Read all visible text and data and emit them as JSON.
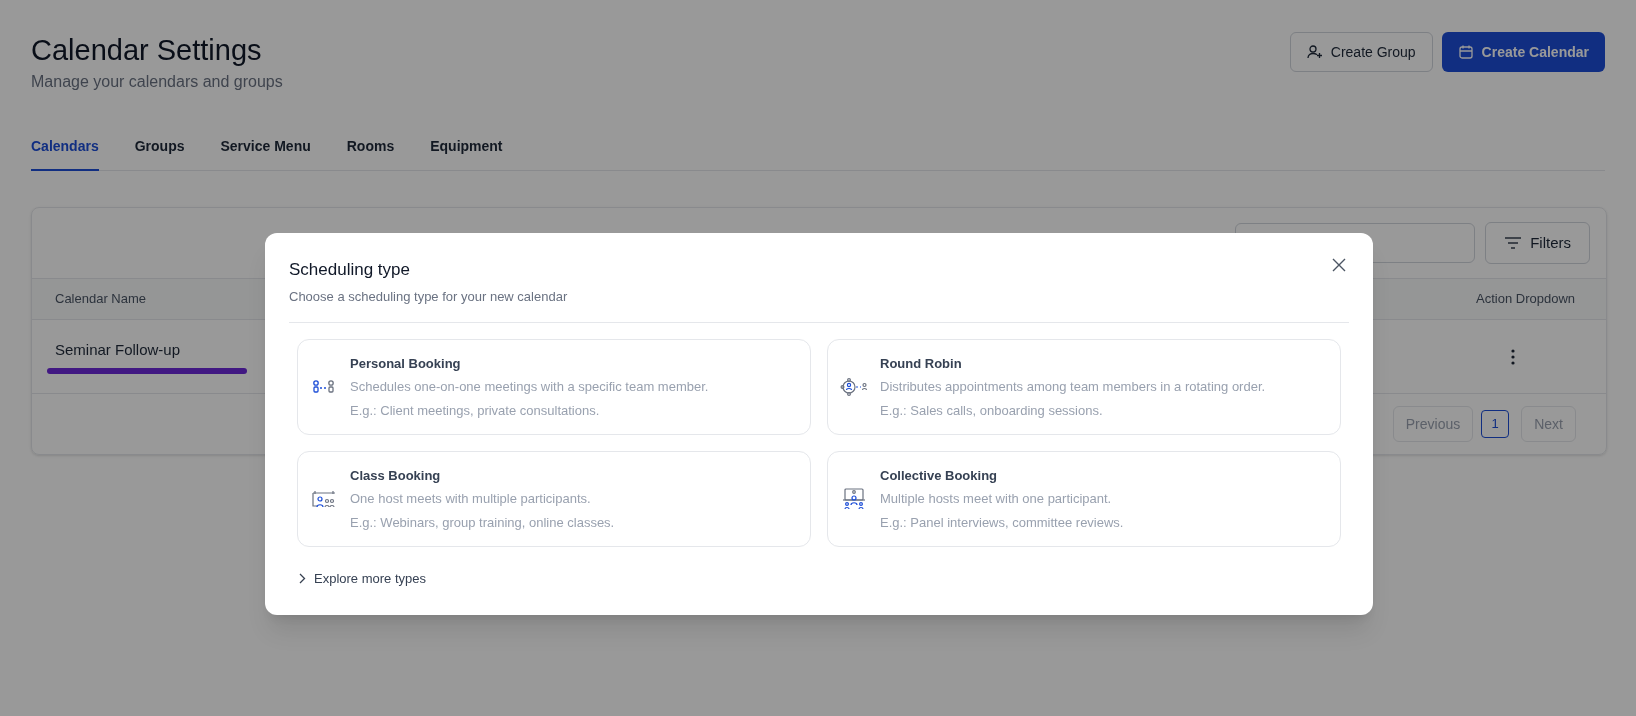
{
  "header": {
    "title": "Calendar Settings",
    "subtitle": "Manage your calendars and groups",
    "buttons": [
      {
        "label": "Create Group",
        "kind": "secondary"
      },
      {
        "label": "Create Calendar",
        "kind": "primary"
      }
    ]
  },
  "tabs": [
    {
      "label": "Calendars",
      "selected": true
    },
    {
      "label": "Groups",
      "selected": false
    },
    {
      "label": "Service Menu",
      "selected": false
    },
    {
      "label": "Rooms",
      "selected": false
    },
    {
      "label": "Equipment",
      "selected": false
    }
  ],
  "table": {
    "filters": "Filters",
    "columns": [
      "Calendar Name",
      "Action Dropdown"
    ],
    "rows": [
      {
        "name": "Seminar Follow-up"
      }
    ],
    "pagination": {
      "previous": "Previous",
      "pages": [
        {
          "label": "1",
          "selected": true
        }
      ],
      "next": "Next"
    }
  },
  "modal": {
    "title": "Scheduling type",
    "subtitle": "Choose a scheduling type for your new calendar",
    "options": [
      {
        "kind": "personal",
        "title": "Personal Booking",
        "description": "Schedules one-on-one meetings with a specific team member.",
        "example": "E.g.: Client meetings, private consultations."
      },
      {
        "kind": "round_robin",
        "title": "Round Robin",
        "description": "Distributes appointments among team members in a rotating order.",
        "example": "E.g.: Sales calls, onboarding sessions."
      },
      {
        "kind": "class",
        "title": "Class Booking",
        "description": "One host meets with multiple participants.",
        "example": "E.g.: Webinars, group training, online classes."
      },
      {
        "kind": "collective",
        "title": "Collective Booking",
        "description": "Multiple hosts meet with one participant.",
        "example": "E.g.: Panel interviews, committee reviews."
      }
    ],
    "explore": "Explore more types"
  }
}
